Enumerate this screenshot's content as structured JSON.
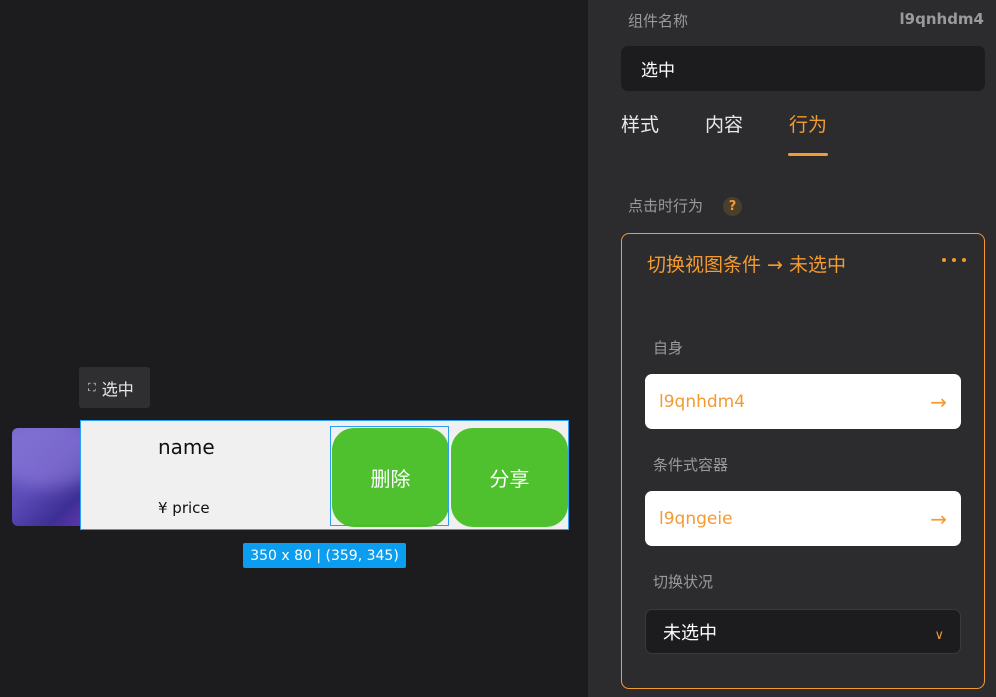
{
  "canvas": {
    "selection_tag": {
      "icon": "frame-select-icon",
      "label": "选中"
    },
    "card": {
      "name": "name",
      "price": "¥ price"
    },
    "buttons": {
      "delete": "删除",
      "share": "分享"
    },
    "size_badge": "350 x 80 | (359, 345)"
  },
  "panel": {
    "component_name_label": "组件名称",
    "component_id": "l9qnhdm4",
    "component_name_value": "选中",
    "tabs": [
      {
        "label": "样式",
        "active": false
      },
      {
        "label": "内容",
        "active": false
      },
      {
        "label": "行为",
        "active": true
      }
    ],
    "on_click_label": "点击时行为",
    "help_icon": "?",
    "action": {
      "title": "切换视图条件 → 未选中",
      "self_label": "自身",
      "self_value": "l9qnhdm4",
      "container_label": "条件式容器",
      "container_value": "l9qngeie",
      "toggle_label": "切换状况",
      "toggle_value": "未选中"
    }
  },
  "colors": {
    "accent": "#f39a31",
    "selection_blue": "#2a9ff5",
    "green_button": "#4fc12f"
  }
}
